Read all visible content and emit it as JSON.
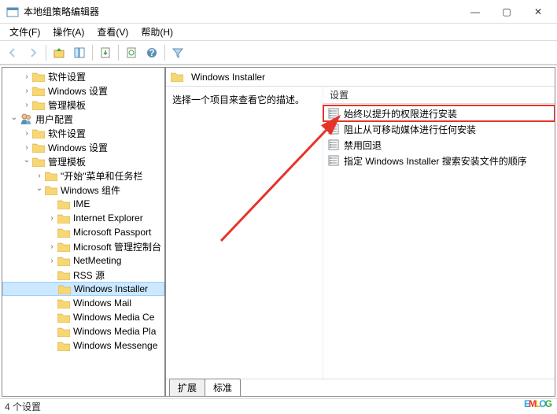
{
  "window": {
    "title": "本地组策略编辑器",
    "controls": {
      "min": "—",
      "max": "▢",
      "close": "✕"
    }
  },
  "menu": {
    "file": "文件(F)",
    "action": "操作(A)",
    "view": "查看(V)",
    "help": "帮助(H)"
  },
  "tree": {
    "items": [
      {
        "indent": 0,
        "chev": "right",
        "label": "软件设置",
        "type": "folder"
      },
      {
        "indent": 0,
        "chev": "right",
        "label": "Windows 设置",
        "type": "folder"
      },
      {
        "indent": 0,
        "chev": "right",
        "label": "管理模板",
        "type": "folder"
      },
      {
        "indent": -1,
        "chev": "down",
        "label": "用户配置",
        "type": "user"
      },
      {
        "indent": 0,
        "chev": "right",
        "label": "软件设置",
        "type": "folder"
      },
      {
        "indent": 0,
        "chev": "right",
        "label": "Windows 设置",
        "type": "folder"
      },
      {
        "indent": 0,
        "chev": "down",
        "label": "管理模板",
        "type": "folder"
      },
      {
        "indent": 1,
        "chev": "right",
        "label": "\"开始\"菜单和任务栏",
        "type": "folder"
      },
      {
        "indent": 1,
        "chev": "down",
        "label": "Windows 组件",
        "type": "folder"
      },
      {
        "indent": 2,
        "chev": "none",
        "label": "IME",
        "type": "folder"
      },
      {
        "indent": 2,
        "chev": "right",
        "label": "Internet Explorer",
        "type": "folder"
      },
      {
        "indent": 2,
        "chev": "none",
        "label": "Microsoft Passport",
        "type": "folder"
      },
      {
        "indent": 2,
        "chev": "right",
        "label": "Microsoft 管理控制台",
        "type": "folder"
      },
      {
        "indent": 2,
        "chev": "right",
        "label": "NetMeeting",
        "type": "folder"
      },
      {
        "indent": 2,
        "chev": "none",
        "label": "RSS 源",
        "type": "folder"
      },
      {
        "indent": 2,
        "chev": "none",
        "label": "Windows Installer",
        "type": "folder",
        "selected": true
      },
      {
        "indent": 2,
        "chev": "none",
        "label": "Windows Mail",
        "type": "folder"
      },
      {
        "indent": 2,
        "chev": "none",
        "label": "Windows Media Ce",
        "type": "folder"
      },
      {
        "indent": 2,
        "chev": "none",
        "label": "Windows Media Pla",
        "type": "folder"
      },
      {
        "indent": 2,
        "chev": "none",
        "label": "Windows Messenge",
        "type": "folder"
      }
    ]
  },
  "content": {
    "header_title": "Windows Installer",
    "description_prompt": "选择一个项目来查看它的描述。",
    "column_header": "设置",
    "items": [
      {
        "label": "始终以提升的权限进行安装",
        "highlighted": true
      },
      {
        "label": "阻止从可移动媒体进行任何安装",
        "highlighted": false
      },
      {
        "label": "禁用回退",
        "highlighted": false
      },
      {
        "label": "指定 Windows Installer 搜索安装文件的顺序",
        "highlighted": false
      }
    ],
    "tabs": {
      "extended": "扩展",
      "standard": "标准"
    }
  },
  "statusbar": {
    "text": "4 个设置"
  },
  "watermark": {
    "letters": [
      {
        "char": "E",
        "color": "#2aa8e0"
      },
      {
        "char": "M",
        "color": "#e6332a"
      },
      {
        "char": "L",
        "color": "#f7a600"
      },
      {
        "char": "O",
        "color": "#2aa8e0"
      },
      {
        "char": "G",
        "color": "#3aaa35"
      }
    ]
  }
}
